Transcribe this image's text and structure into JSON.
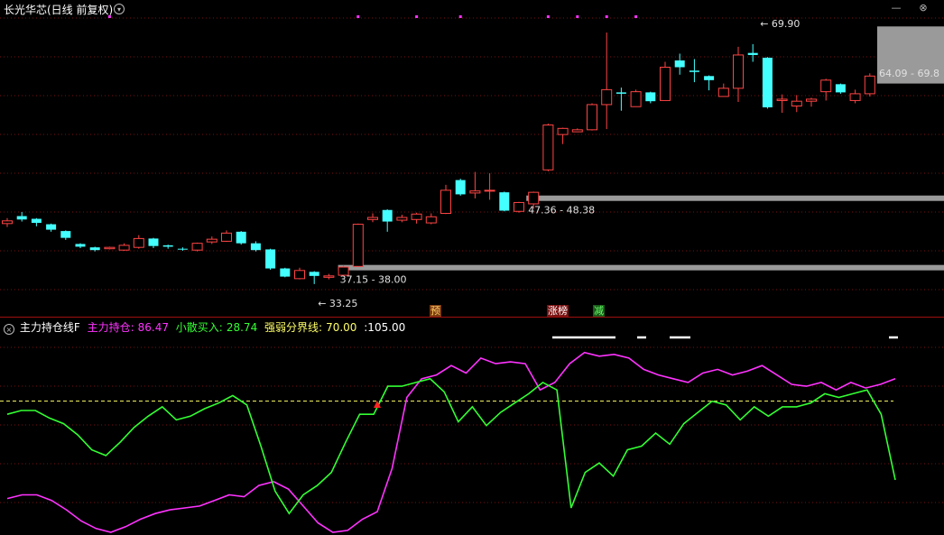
{
  "header": {
    "title": "长光华芯(日线 前复权)",
    "menu_glyph": "▾",
    "minimize_glyph": "—",
    "close_glyph": "⊗"
  },
  "indicator": {
    "name": "主力持仓线F",
    "items": [
      {
        "label": "主力持仓:",
        "value": "86.47",
        "color": "#ff33ff"
      },
      {
        "label": "小散买入:",
        "value": "28.74",
        "color": "#33ff33"
      },
      {
        "label": "强弱分界线:",
        "value": "70.00",
        "color": "#ffff66"
      }
    ],
    "extra": ":105.00"
  },
  "annotations": {
    "high_label": "69.90",
    "low_label": "33.25",
    "right_label": "64.09 - 69.8",
    "zone_upper_label": "47.36 - 48.38",
    "zone_lower_label": "37.15 - 38.00"
  },
  "signals": [
    {
      "text": "预",
      "bg": "#7a3a10",
      "color": "#ffcc66"
    },
    {
      "text": "涨榜",
      "bg": "#7a1010",
      "color": "#ffffff"
    },
    {
      "text": "减",
      "bg": "#1a5a1a",
      "color": "#66ff66"
    }
  ],
  "colors": {
    "up": "#ff4444",
    "down": "#44ffff",
    "main_force": "#ff33ff",
    "retail": "#33ff33",
    "boundary": "#ffff66",
    "zone": "#9a9a9a",
    "dot": "#ff33ff",
    "grid": "#7a1010"
  },
  "chart_data": [
    {
      "type": "candlestick",
      "title": "长光华芯(日线 前复权)",
      "ylim": [
        31,
        74
      ],
      "candles": [
        [
          43.5,
          43.9,
          43.0,
          44.3
        ],
        [
          44.6,
          44.1,
          43.8,
          45.2
        ],
        [
          44.2,
          43.6,
          43.1,
          44.3
        ],
        [
          43.4,
          42.6,
          42.3,
          43.5
        ],
        [
          42.4,
          41.4,
          41.1,
          42.5
        ],
        [
          40.5,
          40.1,
          39.9,
          40.6
        ],
        [
          40.0,
          39.6,
          39.4,
          40.1
        ],
        [
          39.8,
          40.0,
          39.7,
          40.1
        ],
        [
          39.6,
          40.3,
          39.5,
          40.6
        ],
        [
          40.0,
          41.3,
          39.8,
          41.8
        ],
        [
          41.3,
          40.2,
          39.9,
          41.4
        ],
        [
          40.3,
          40.1,
          39.8,
          40.4
        ],
        [
          39.8,
          39.7,
          39.5,
          40.0
        ],
        [
          39.6,
          40.6,
          39.4,
          40.7
        ],
        [
          40.8,
          41.2,
          40.5,
          41.6
        ],
        [
          40.9,
          42.1,
          40.8,
          42.5
        ],
        [
          42.3,
          40.6,
          40.4,
          42.4
        ],
        [
          40.6,
          39.6,
          39.4,
          40.9
        ],
        [
          39.7,
          36.9,
          36.7,
          39.8
        ],
        [
          36.9,
          35.7,
          35.6,
          37.0
        ],
        [
          35.4,
          36.6,
          35.3,
          37.0
        ],
        [
          36.4,
          35.8,
          34.6,
          36.5
        ],
        [
          35.6,
          35.8,
          35.3,
          36.1
        ],
        [
          35.9,
          37.1,
          35.8,
          37.4
        ],
        [
          37.2,
          43.4,
          37.2,
          43.5
        ],
        [
          44.1,
          44.4,
          43.7,
          45.0
        ],
        [
          45.5,
          43.8,
          42.3,
          45.6
        ],
        [
          44.0,
          44.4,
          43.7,
          44.8
        ],
        [
          44.1,
          44.9,
          43.5,
          45.1
        ],
        [
          43.6,
          44.5,
          43.4,
          45.0
        ],
        [
          45.0,
          48.4,
          44.9,
          49.2
        ],
        [
          49.9,
          47.8,
          47.6,
          50.1
        ],
        [
          48.0,
          48.3,
          47.2,
          51.1
        ],
        [
          48.3,
          48.4,
          47.0,
          50.9
        ],
        [
          48.1,
          45.4,
          45.3,
          48.2
        ],
        [
          45.3,
          46.6,
          45.1,
          46.7
        ],
        [
          46.4,
          48.1,
          45.7,
          48.2
        ],
        [
          51.4,
          58.0,
          51.2,
          58.2
        ],
        [
          56.6,
          57.5,
          55.2,
          57.6
        ],
        [
          57.0,
          57.3,
          57.0,
          57.5
        ],
        [
          57.3,
          61.0,
          57.2,
          61.2
        ],
        [
          61.0,
          63.2,
          57.4,
          71.6
        ],
        [
          62.8,
          62.6,
          60.1,
          63.5
        ],
        [
          60.7,
          62.9,
          60.7,
          63.2
        ],
        [
          62.8,
          61.5,
          61.2,
          62.9
        ],
        [
          61.6,
          66.5,
          61.6,
          67.3
        ],
        [
          67.5,
          66.5,
          65.4,
          68.5
        ],
        [
          66.0,
          65.8,
          64.3,
          67.7
        ],
        [
          65.2,
          64.6,
          63.1,
          65.3
        ],
        [
          62.2,
          63.4,
          62.2,
          64.1
        ],
        [
          63.4,
          68.3,
          61.4,
          69.5
        ],
        [
          68.6,
          68.3,
          67.3,
          69.9
        ],
        [
          67.9,
          60.6,
          60.4,
          68.0
        ],
        [
          61.6,
          61.8,
          59.8,
          62.5
        ],
        [
          60.8,
          61.5,
          59.9,
          62.4
        ],
        [
          61.5,
          61.8,
          60.7,
          62.0
        ],
        [
          62.9,
          64.6,
          61.6,
          64.8
        ],
        [
          64.0,
          62.8,
          62.6,
          64.1
        ],
        [
          61.6,
          62.6,
          61.2,
          63.2
        ],
        [
          62.6,
          65.2,
          62.2,
          65.6
        ]
      ],
      "markers": {
        "high": 69.9,
        "low": 33.25
      },
      "zones": [
        [
          47.36,
          48.38
        ],
        [
          37.15,
          38.0
        ],
        [
          64.09,
          69.8
        ]
      ]
    },
    {
      "type": "line",
      "title": "主力持仓线F",
      "ylim": [
        0,
        105
      ],
      "boundary": 70.0,
      "series": [
        {
          "name": "主力持仓",
          "values": [
            18,
            20,
            20,
            17,
            12,
            6,
            2,
            0,
            3,
            7,
            10,
            12,
            13,
            14,
            17,
            20,
            19,
            25,
            27,
            23,
            14,
            5,
            0,
            1,
            7,
            11,
            34,
            72,
            82,
            84,
            89,
            85,
            93,
            90,
            91,
            90,
            76,
            80,
            90,
            96,
            94,
            95,
            93,
            87,
            84,
            82,
            80,
            85,
            87,
            84,
            86,
            89,
            84,
            79,
            78,
            80,
            76,
            80,
            77,
            79,
            82
          ]
        },
        {
          "name": "小散买入",
          "values": [
            63,
            65,
            65,
            61,
            58,
            52,
            44,
            41,
            48,
            56,
            62,
            67,
            60,
            62,
            66,
            69,
            73,
            68,
            46,
            22,
            10,
            20,
            25,
            32,
            48,
            63,
            63,
            78,
            78,
            80,
            82,
            75,
            59,
            67,
            57,
            64,
            69,
            74,
            80,
            76,
            13,
            32,
            37,
            30,
            44,
            46,
            53,
            47,
            58,
            64,
            70,
            68,
            60,
            67,
            62,
            67,
            67,
            69,
            74,
            72,
            74,
            76,
            63,
            28
          ]
        }
      ]
    }
  ]
}
